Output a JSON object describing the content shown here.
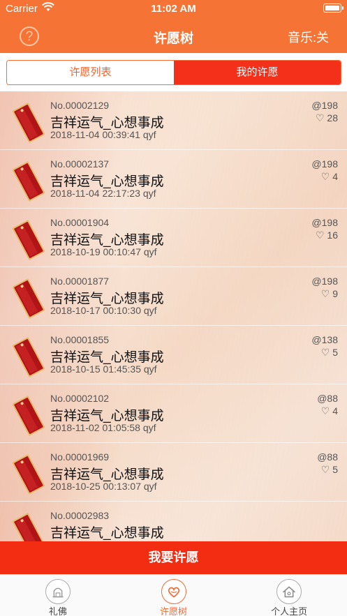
{
  "status": {
    "carrier": "Carrier",
    "time": "11:02 AM"
  },
  "header": {
    "help_glyph": "?",
    "title": "许愿树",
    "music_label": "音乐:关"
  },
  "segments": {
    "list_label": "许愿列表",
    "mine_label": "我的许愿",
    "selected": "许愿列表"
  },
  "wishes": [
    {
      "no": "No.00002129",
      "title": "吉祥运气_心想事成",
      "meta": "2018-11-04 00:39:41 qyf",
      "coins": "@198",
      "likes": "♡ 28"
    },
    {
      "no": "No.00002137",
      "title": "吉祥运气_心想事成",
      "meta": "2018-11-04 22:17:23 qyf",
      "coins": "@198",
      "likes": "♡ 4"
    },
    {
      "no": "No.00001904",
      "title": "吉祥运气_心想事成",
      "meta": "2018-10-19 00:10:47 qyf",
      "coins": "@198",
      "likes": "♡ 16"
    },
    {
      "no": "No.00001877",
      "title": "吉祥运气_心想事成",
      "meta": "2018-10-17 00:10:30 qyf",
      "coins": "@198",
      "likes": "♡ 9"
    },
    {
      "no": "No.00001855",
      "title": "吉祥运气_心想事成",
      "meta": "2018-10-15 01:45:35 qyf",
      "coins": "@138",
      "likes": "♡ 5"
    },
    {
      "no": "No.00002102",
      "title": "吉祥运气_心想事成",
      "meta": "2018-11-02 01:05:58 qyf",
      "coins": "@88",
      "likes": "♡ 4"
    },
    {
      "no": "No.00001969",
      "title": "吉祥运气_心想事成",
      "meta": "2018-10-25 00:13:07 qyf",
      "coins": "@88",
      "likes": "♡ 5"
    },
    {
      "no": "No.00002983",
      "title": "吉祥运气_心想事成",
      "meta": "",
      "coins": "",
      "likes": ""
    }
  ],
  "wish_button": "我要许愿",
  "tabs": [
    {
      "label": "礼佛",
      "icon": "temple-icon",
      "active": false
    },
    {
      "label": "许愿树",
      "icon": "heart-icon",
      "active": true
    },
    {
      "label": "个人主页",
      "icon": "house-icon",
      "active": false
    }
  ],
  "colors": {
    "accent": "#f57435",
    "segment_active": "#f5301a",
    "wish_button": "#f22d12"
  }
}
